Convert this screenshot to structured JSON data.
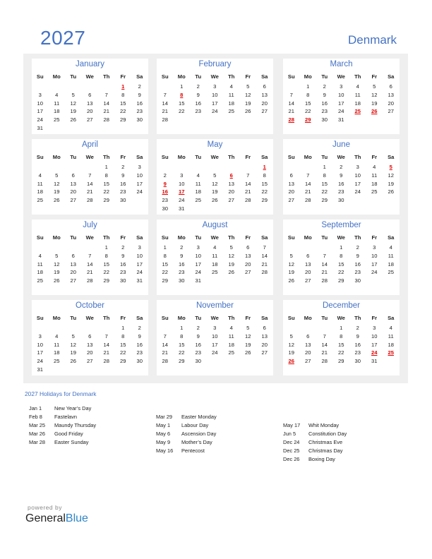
{
  "header": {
    "year": "2027",
    "country": "Denmark"
  },
  "weekday_labels": [
    "Su",
    "Mo",
    "Tu",
    "We",
    "Th",
    "Fr",
    "Sa"
  ],
  "colors": {
    "accent": "#4472c4",
    "holiday": "#e00000",
    "grid_bg": "#efefef",
    "brand_blue": "#2f86c8"
  },
  "months": [
    {
      "name": "January",
      "first_weekday": 5,
      "days": 31,
      "holidays": [
        1
      ]
    },
    {
      "name": "February",
      "first_weekday": 1,
      "days": 28,
      "holidays": [
        8
      ]
    },
    {
      "name": "March",
      "first_weekday": 1,
      "days": 31,
      "holidays": [
        25,
        26,
        28,
        29
      ]
    },
    {
      "name": "April",
      "first_weekday": 4,
      "days": 30,
      "holidays": []
    },
    {
      "name": "May",
      "first_weekday": 6,
      "days": 31,
      "holidays": [
        1,
        6,
        9,
        16,
        17
      ]
    },
    {
      "name": "June",
      "first_weekday": 2,
      "days": 30,
      "holidays": [
        5
      ]
    },
    {
      "name": "July",
      "first_weekday": 4,
      "days": 31,
      "holidays": []
    },
    {
      "name": "August",
      "first_weekday": 0,
      "days": 31,
      "holidays": []
    },
    {
      "name": "September",
      "first_weekday": 3,
      "days": 30,
      "holidays": []
    },
    {
      "name": "October",
      "first_weekday": 5,
      "days": 31,
      "holidays": []
    },
    {
      "name": "November",
      "first_weekday": 1,
      "days": 30,
      "holidays": []
    },
    {
      "name": "December",
      "first_weekday": 3,
      "days": 31,
      "holidays": [
        24,
        25,
        26
      ]
    }
  ],
  "holidays_section": {
    "title": "2027 Holidays for Denmark",
    "columns": [
      [
        {
          "date": "Jan 1",
          "name": "New Year’s Day"
        },
        {
          "date": "Feb 8",
          "name": "Fastelavn"
        },
        {
          "date": "Mar 25",
          "name": "Maundy Thursday"
        },
        {
          "date": "Mar 26",
          "name": "Good Friday"
        },
        {
          "date": "Mar 28",
          "name": "Easter Sunday"
        }
      ],
      [
        {
          "date": "Mar 29",
          "name": "Easter Monday"
        },
        {
          "date": "May 1",
          "name": "Labour Day"
        },
        {
          "date": "May 6",
          "name": "Ascension Day"
        },
        {
          "date": "May 9",
          "name": "Mother’s Day"
        },
        {
          "date": "May 16",
          "name": "Pentecost"
        }
      ],
      [
        {
          "date": "May 17",
          "name": "Whit Monday"
        },
        {
          "date": "Jun 5",
          "name": "Constitution Day"
        },
        {
          "date": "Dec 24",
          "name": "Christmas Eve"
        },
        {
          "date": "Dec 25",
          "name": "Christmas Day"
        },
        {
          "date": "Dec 26",
          "name": "Boxing Day"
        }
      ]
    ]
  },
  "footer": {
    "powered_by": "powered by",
    "brand_part1": "General",
    "brand_part2": "Blue"
  }
}
